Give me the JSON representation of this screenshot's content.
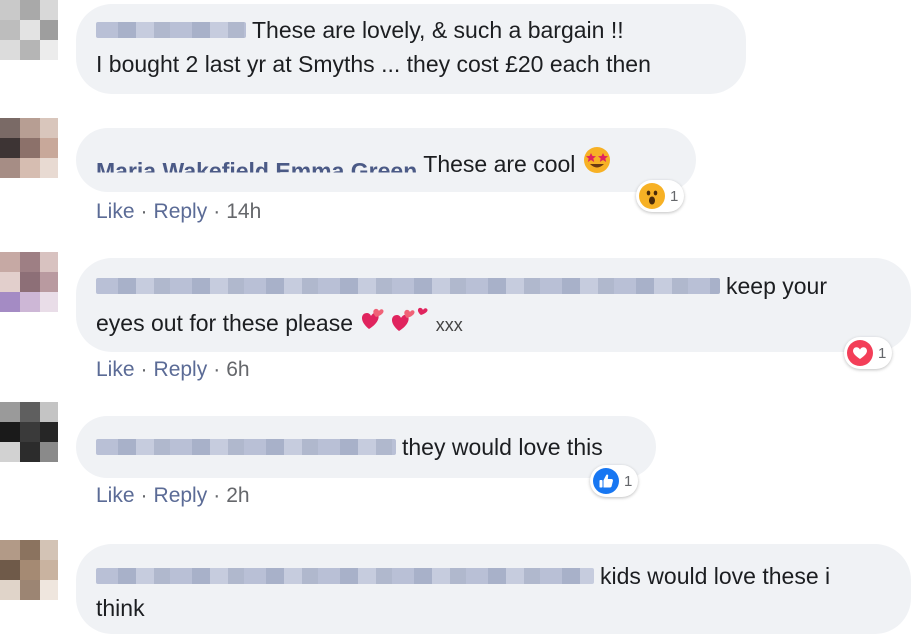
{
  "comments": [
    {
      "line1": "These are lovely, & such a bargain !!",
      "line2": "I bought 2 last yr at Smyths ... they cost £20 each then"
    },
    {
      "name_fragment": "Maria Wakefield  Emma Green",
      "text": "These are cool",
      "actions": {
        "like": "Like",
        "reply": "Reply",
        "time": "14h"
      },
      "reaction": {
        "icon": "wow-emoji-icon",
        "count": "1"
      }
    },
    {
      "line1": "keep your",
      "line2": "eyes out for these please",
      "line2_suffix": "xxx",
      "actions": {
        "like": "Like",
        "reply": "Reply",
        "time": "6h"
      },
      "reaction": {
        "icon": "love-heart-icon",
        "count": "1"
      }
    },
    {
      "text": "they would love this",
      "actions": {
        "like": "Like",
        "reply": "Reply",
        "time": "2h"
      },
      "reaction": {
        "icon": "like-thumb-icon",
        "count": "1"
      }
    },
    {
      "line1": "kids would love these i",
      "line2": "think"
    }
  ],
  "separator": "·",
  "colors": {
    "bubble": "#f0f2f5",
    "action_link": "#5b6b96",
    "love": "#f33e58",
    "like": "#1877f2",
    "wow": "#f7b125"
  }
}
